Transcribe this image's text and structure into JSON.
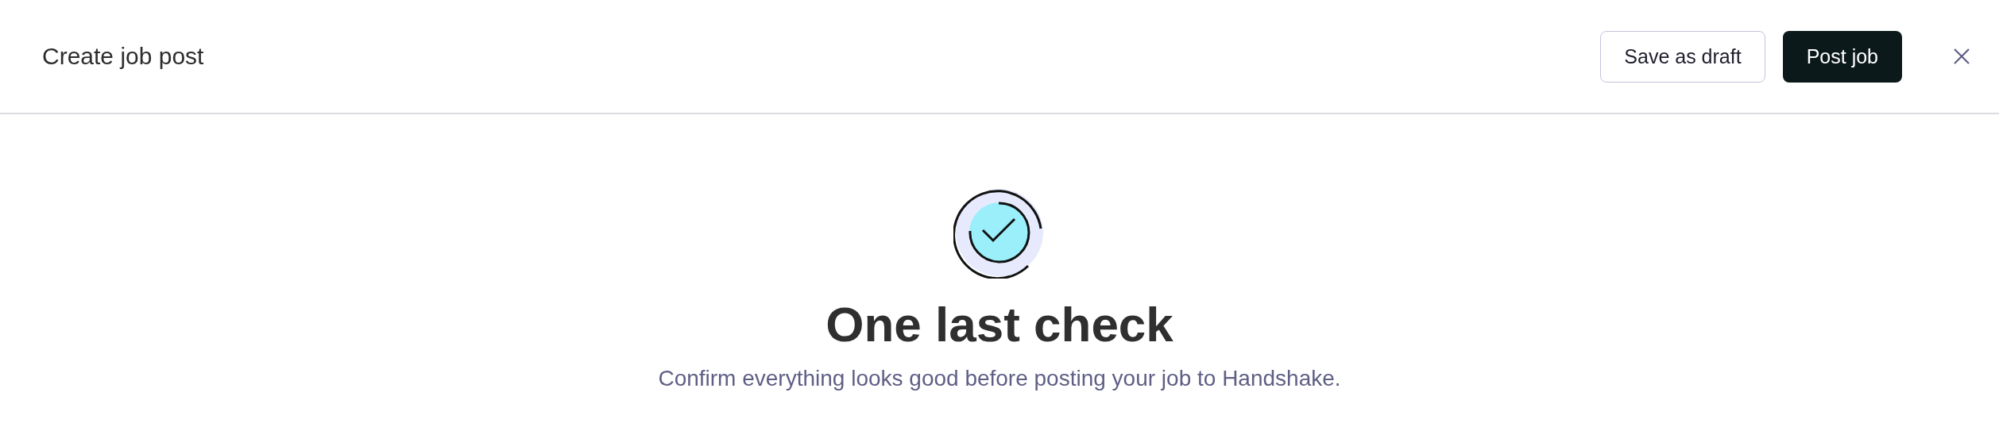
{
  "header": {
    "title": "Create job post",
    "buttons": [
      {
        "label": "Save as draft",
        "kind": "secondary"
      },
      {
        "label": "Post job",
        "kind": "primary"
      }
    ]
  },
  "confirmation": {
    "heading": "One last check",
    "message": "Confirm everything looks good before posting your job to Handshake."
  }
}
